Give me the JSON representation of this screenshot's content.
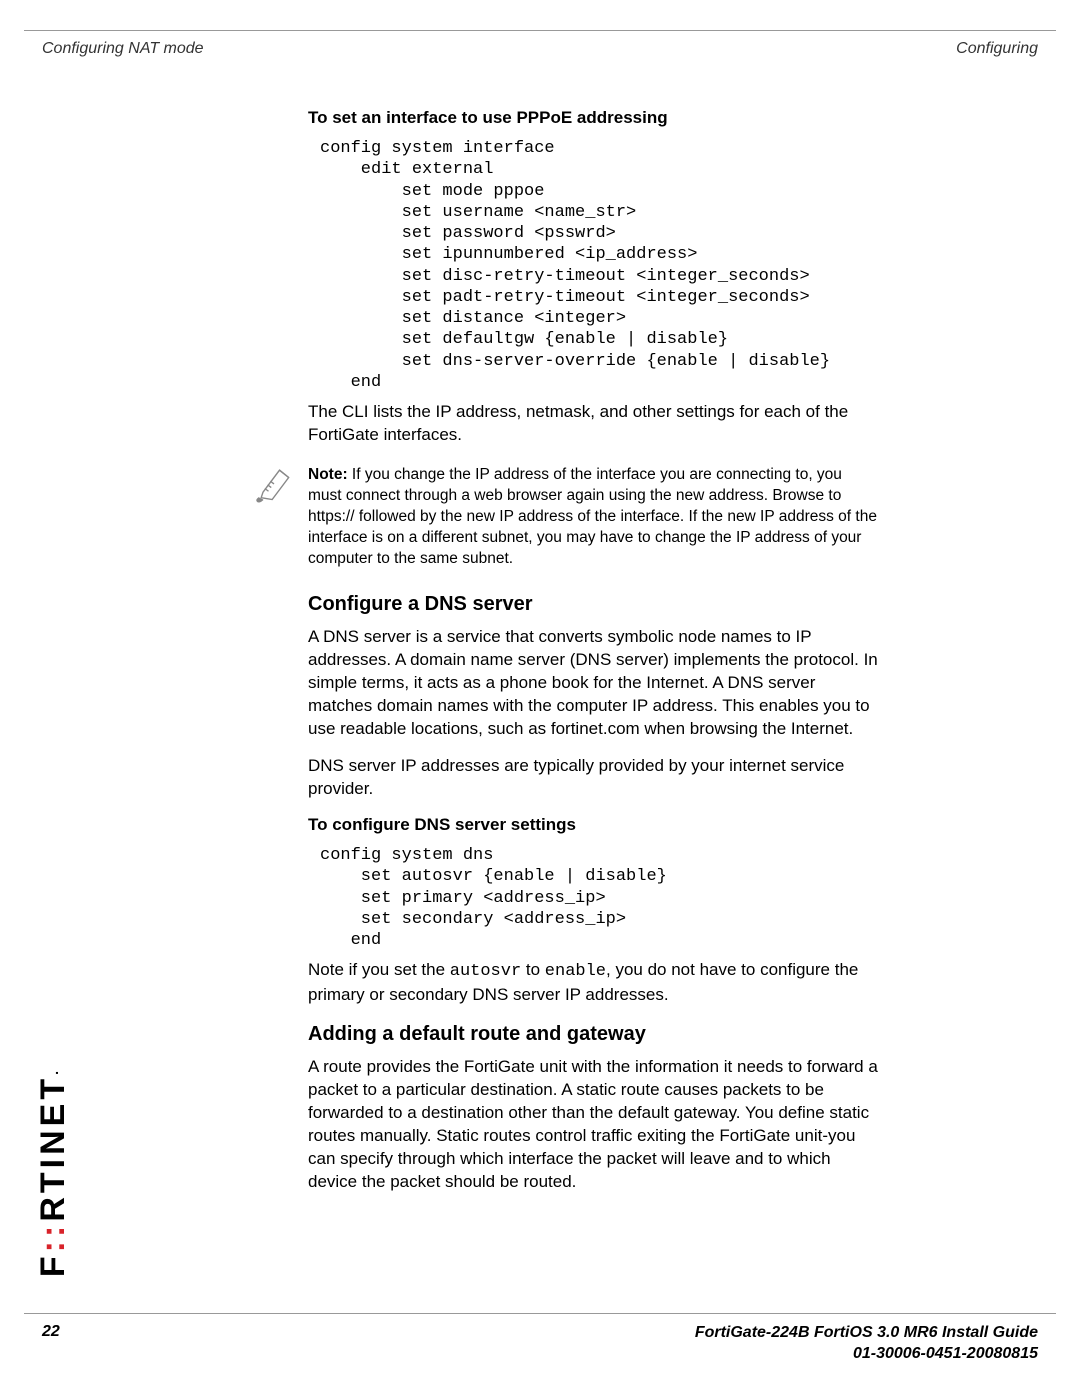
{
  "header": {
    "left": "Configuring NAT mode",
    "right": "Configuring"
  },
  "section1": {
    "title": "To set an interface to use PPPoE addressing",
    "code": "config system interface\n    edit external\n        set mode pppoe\n        set username <name_str>\n        set password <psswrd>\n        set ipunnumbered <ip_address>\n        set disc-retry-timeout <integer_seconds>\n        set padt-retry-timeout <integer_seconds>\n        set distance <integer>\n        set defaultgw {enable | disable}\n        set dns-server-override {enable | disable}\n   end",
    "after": "The CLI lists the IP address, netmask, and other settings for each of the FortiGate interfaces."
  },
  "note": {
    "label": "Note:",
    "text": " If you change the IP address of the interface you are connecting to, you must connect through a web browser again using the new address. Browse to https:// followed by the new IP address of the interface. If the new IP address of the interface is on a different subnet, you may have to change the IP address of your computer to the same subnet."
  },
  "dns": {
    "heading": "Configure a DNS server",
    "p1": "A DNS server is a service that converts symbolic node names to IP addresses. A domain name server (DNS server) implements the protocol. In simple terms, it acts as a phone book for the Internet. A DNS server matches domain names with the computer IP address. This enables you to use readable locations, such as fortinet.com when browsing the Internet.",
    "p2": "DNS server IP addresses are typically provided by your internet service provider.",
    "subheading": "To configure DNS server settings",
    "code": "config system dns\n    set autosvr {enable | disable}\n    set primary <address_ip>\n    set secondary <address_ip>\n   end",
    "p3a": "Note if you set the ",
    "p3m1": "autosvr",
    "p3b": " to ",
    "p3m2": "enable",
    "p3c": ", you do not have to configure the primary or secondary DNS server IP addresses."
  },
  "route": {
    "heading": "Adding a default route and gateway",
    "p1": "A route provides the FortiGate unit with the information it needs to forward a packet to a particular destination. A static route causes packets to be forwarded to a destination other than the default gateway. You define static routes manually. Static routes control traffic exiting the FortiGate unit-you can specify through which interface the packet will leave and to which device the packet should be routed."
  },
  "footer": {
    "page": "22",
    "line1": "FortiGate-224B FortiOS 3.0 MR6 Install Guide",
    "line2": "01-30006-0451-20080815"
  },
  "logo": "F RTINET"
}
